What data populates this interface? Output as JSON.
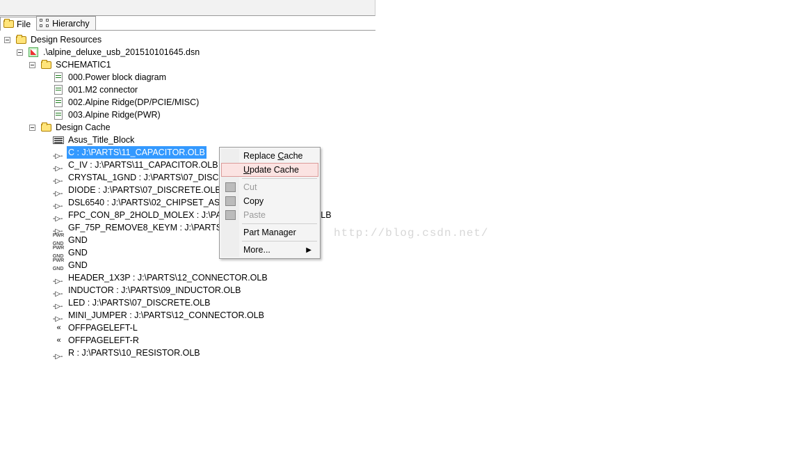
{
  "tabs": {
    "file": "File",
    "hierarchy": "Hierarchy"
  },
  "tree": {
    "root": "Design Resources",
    "dsn": ".\\alpine_deluxe_usb_201510101645.dsn",
    "schematic_folder": "SCHEMATIC1",
    "pages": [
      "000.Power block diagram",
      "001.M2 connector",
      "002.Alpine Ridge(DP/PCIE/MISC)",
      "003.Alpine Ridge(PWR)"
    ],
    "cache_folder": "Design Cache",
    "cache_items": [
      {
        "icon": "title",
        "label": "Asus_Title_Block"
      },
      {
        "icon": "part",
        "label": "C : J:\\PARTS\\11_CAPACITOR.OLB",
        "selected": true
      },
      {
        "icon": "part",
        "label": "C_IV : J:\\PARTS\\11_CAPACITOR.OLB"
      },
      {
        "icon": "part",
        "label": "CRYSTAL_1GND : J:\\PARTS\\07_DISCRETE.OLB"
      },
      {
        "icon": "part",
        "label": "DIODE : J:\\PARTS\\07_DISCRETE.OLB"
      },
      {
        "icon": "part",
        "label": "DSL6540 : J:\\PARTS\\02_CHIPSET_ASIC.OLB"
      },
      {
        "icon": "part",
        "label": "FPC_CON_8P_2HOLD_MOLEX : J:\\PARTS\\12_CONNECTOR.OLB"
      },
      {
        "icon": "part",
        "label": "GF_75P_REMOVE8_KEYM : J:\\PARTS\\12_CONNECTOR.OLB"
      },
      {
        "icon": "pwr",
        "label": "GND"
      },
      {
        "icon": "pwr",
        "label": "GND"
      },
      {
        "icon": "pwr",
        "label": "GND"
      },
      {
        "icon": "part",
        "label": "HEADER_1X3P : J:\\PARTS\\12_CONNECTOR.OLB"
      },
      {
        "icon": "part",
        "label": "INDUCTOR : J:\\PARTS\\09_INDUCTOR.OLB"
      },
      {
        "icon": "part",
        "label": "LED : J:\\PARTS\\07_DISCRETE.OLB"
      },
      {
        "icon": "part",
        "label": "MINI_JUMPER : J:\\PARTS\\12_CONNECTOR.OLB"
      },
      {
        "icon": "offpage",
        "label": "OFFPAGELEFT-L"
      },
      {
        "icon": "offpage",
        "label": "OFFPAGELEFT-R"
      },
      {
        "icon": "part",
        "label": "R : J:\\PARTS\\10_RESISTOR.OLB"
      }
    ]
  },
  "context_menu": {
    "replace_cache": "Replace Cache",
    "update_cache": "Update Cache",
    "cut": "Cut",
    "copy": "Copy",
    "paste": "Paste",
    "part_manager": "Part Manager",
    "more": "More..."
  },
  "watermark": "http://blog.csdn.net/"
}
